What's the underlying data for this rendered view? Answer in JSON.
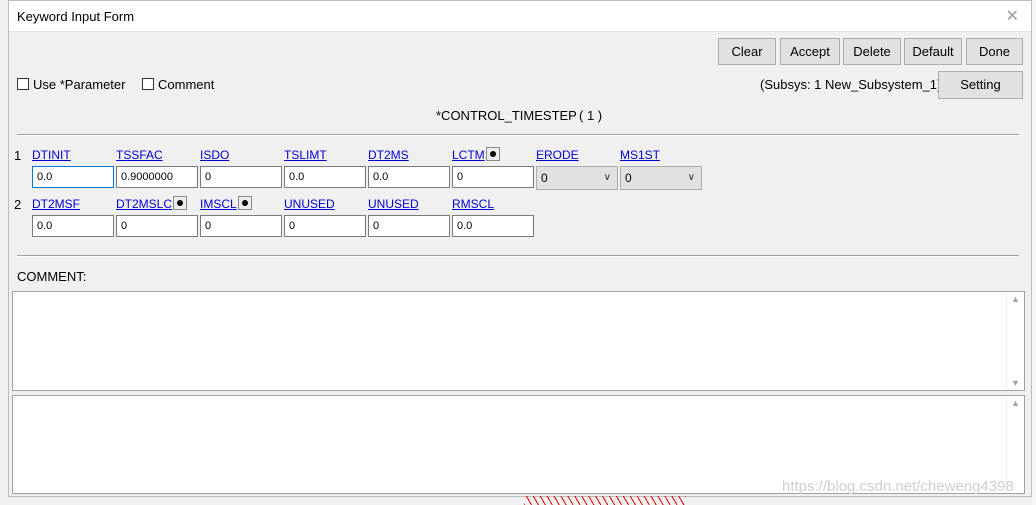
{
  "window": {
    "title": "Keyword Input Form"
  },
  "toolbar": {
    "clear": "Clear",
    "accept": "Accept",
    "delete": "Delete",
    "default": "Default",
    "done": "Done",
    "setting": "Setting"
  },
  "options": {
    "use_parameter": "Use *Parameter",
    "comment": "Comment"
  },
  "subsys": "(Subsys: 1 New_Subsystem_1)",
  "keyword": {
    "name": "*CONTROL_TIMESTEP",
    "index": "( 1 )"
  },
  "rows": [
    {
      "num": "1",
      "fields": [
        {
          "label": "DTINIT",
          "value": "0.0"
        },
        {
          "label": "TSSFAC",
          "value": "0.9000000"
        },
        {
          "label": "ISDO",
          "value": "0"
        },
        {
          "label": "TSLIMT",
          "value": "0.0"
        },
        {
          "label": "DT2MS",
          "value": "0.0"
        },
        {
          "label": "LCTM",
          "value": "0"
        },
        {
          "label": "ERODE",
          "value": "0"
        },
        {
          "label": "MS1ST",
          "value": "0"
        }
      ]
    },
    {
      "num": "2",
      "fields": [
        {
          "label": "DT2MSF",
          "value": "0.0"
        },
        {
          "label": "DT2MSLC",
          "value": "0"
        },
        {
          "label": "IMSCL",
          "value": "0"
        },
        {
          "label": "UNUSED",
          "value": "0"
        },
        {
          "label": "UNUSED",
          "value": "0"
        },
        {
          "label": "RMSCL",
          "value": "0.0"
        }
      ]
    }
  ],
  "comment_label": "COMMENT:",
  "watermark": "https://blog.csdn.net/cheweng4398",
  "colors": {
    "link": "#0000d0",
    "focus": "#0078d7",
    "button": "#e1e1e1"
  }
}
